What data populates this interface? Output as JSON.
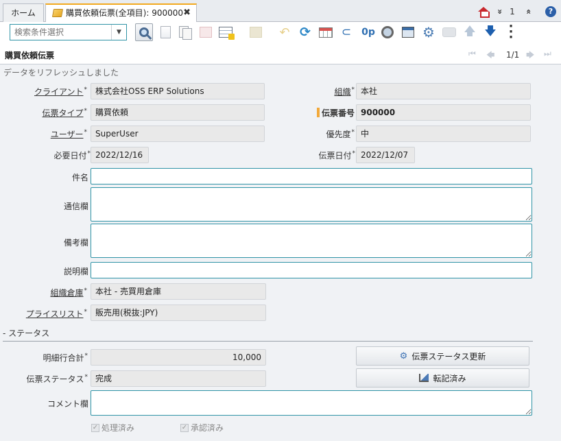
{
  "tabs": {
    "home_label": "ホーム",
    "active_label": "購買依頼伝票(全項目): 900000",
    "close_glyph": "✖"
  },
  "topright": {
    "expand_glyph": "»",
    "count": "1",
    "collapse_glyph": "«",
    "help_glyph": "?"
  },
  "toolbar": {
    "search_placeholder": "検索条件選択"
  },
  "window": {
    "title": "購買依頼伝票",
    "page_indicator": "1/1"
  },
  "status_message": "データをリフレッシュしました",
  "fields": {
    "client": {
      "label": "クライアント",
      "value": "株式会社OSS ERP Solutions"
    },
    "org": {
      "label": "組織",
      "value": "本社"
    },
    "doctype": {
      "label": "伝票タイプ",
      "value": "購買依頼"
    },
    "docno": {
      "label": "伝票番号",
      "value": "900000"
    },
    "user": {
      "label": "ユーザー",
      "value": "SuperUser"
    },
    "priority": {
      "label": "優先度",
      "value": "中"
    },
    "date_required": {
      "label": "必要日付",
      "value": "2022/12/16"
    },
    "date_doc": {
      "label": "伝票日付",
      "value": "2022/12/07"
    },
    "subject": {
      "label": "件名",
      "value": ""
    },
    "comm": {
      "label": "通信欄",
      "value": ""
    },
    "note": {
      "label": "備考欄",
      "value": ""
    },
    "desc": {
      "label": "説明欄",
      "value": ""
    },
    "warehouse": {
      "label": "組織倉庫",
      "value": "本社 - 売買用倉庫"
    },
    "pricelist": {
      "label": "プライスリスト",
      "value": "販売用(税抜:JPY)"
    },
    "total": {
      "label": "明細行合計",
      "value": "10,000"
    },
    "docstatus": {
      "label": "伝票ステータス",
      "value": "完成"
    },
    "comment": {
      "label": "コメント欄",
      "value": ""
    }
  },
  "section_status": "- ステータス",
  "buttons": {
    "update_status": "伝票ステータス更新",
    "posted": "転記済み"
  },
  "checkboxes": {
    "processed": "処理済み",
    "approved": "承認済み"
  },
  "mandatory_mark": "*",
  "colors": {
    "accent": "#2f93a6",
    "tab_highlight": "#f2a91e",
    "readonly_bg": "#e9e9e9"
  }
}
